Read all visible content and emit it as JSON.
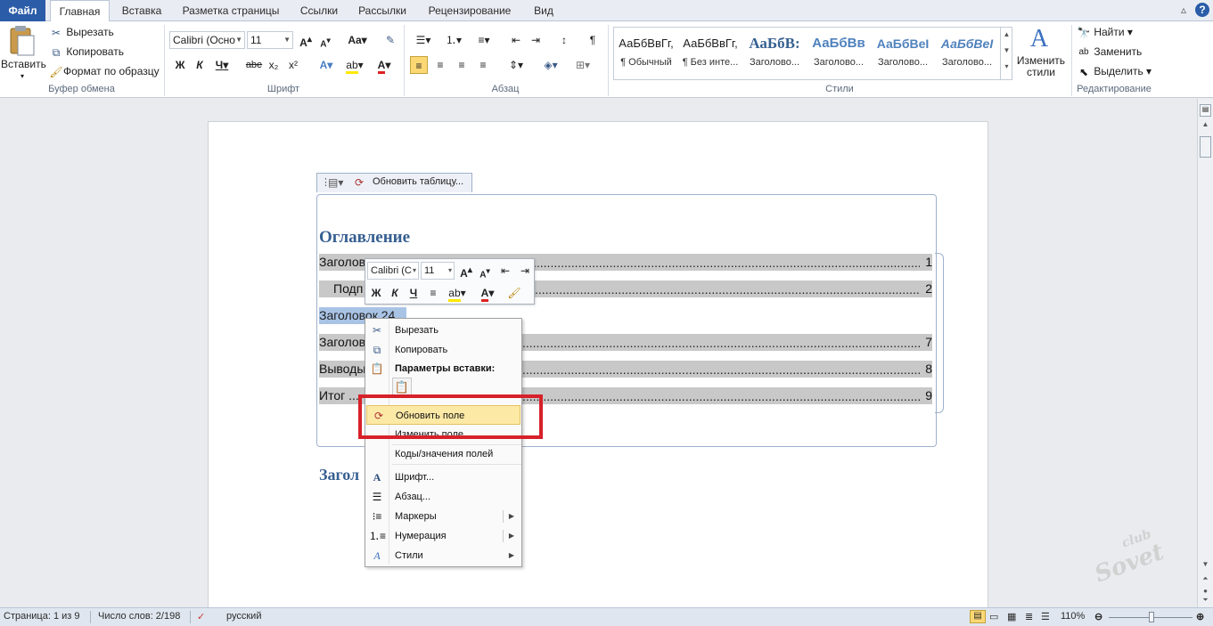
{
  "tabs": {
    "file": "Файл",
    "home": "Главная",
    "insert": "Вставка",
    "layout": "Разметка страницы",
    "references": "Ссылки",
    "mailings": "Рассылки",
    "review": "Рецензирование",
    "view": "Вид"
  },
  "clipboard": {
    "paste": "Вставить",
    "cut": "Вырезать",
    "copy": "Копировать",
    "format_painter": "Формат по образцу",
    "title": "Буфер обмена"
  },
  "font": {
    "name": "Calibri (Осно",
    "size": "11",
    "title": "Шрифт",
    "bold": "Ж",
    "italic": "К",
    "underline": "Ч",
    "strike": "abe",
    "subscript": "x₂",
    "superscript": "x²"
  },
  "paragraph": {
    "title": "Абзац"
  },
  "styles": {
    "title": "Стили",
    "items": [
      {
        "preview": "АаБбВвГг,",
        "name": "¶ Обычный"
      },
      {
        "preview": "АаБбВвГг,",
        "name": "¶ Без инте..."
      },
      {
        "preview": "АаБбВ:",
        "name": "Заголово..."
      },
      {
        "preview": "АаБбВв",
        "name": "Заголово..."
      },
      {
        "preview": "АаБбВеІ",
        "name": "Заголово..."
      },
      {
        "preview": "АаБбВеІ",
        "name": "Заголово..."
      }
    ],
    "change_styles": "Изменить стили"
  },
  "editing": {
    "find": "Найти",
    "replace": "Заменить",
    "select": "Выделить",
    "title": "Редактирование"
  },
  "toc": {
    "update_table": "Обновить таблицу...",
    "heading": "Оглавление",
    "rows": [
      {
        "text": "Заголов",
        "page": "1"
      },
      {
        "text": "Подп",
        "page": "2"
      },
      {
        "text": "Заголов",
        "page": "7"
      },
      {
        "text": "Выводы",
        "page": "8"
      },
      {
        "text": "Итог ...",
        "page": "9"
      }
    ],
    "selected_heading": "Заголовок 24",
    "below_heading": "Загол"
  },
  "minibar": {
    "font": "Calibri (С",
    "size": "11"
  },
  "context_menu": {
    "cut": "Вырезать",
    "copy": "Копировать",
    "paste_options": "Параметры вставки:",
    "update_field": "Обновить поле",
    "edit_field": "Изменить поле...",
    "field_codes": "Коды/значения полей",
    "font": "Шрифт...",
    "paragraph": "Абзац...",
    "bullets": "Маркеры",
    "numbering": "Нумерация",
    "styles": "Стили"
  },
  "status": {
    "page": "Страница: 1 из 9",
    "words": "Число слов: 2/198",
    "language": "русский",
    "zoom": "110%"
  },
  "watermark": "club Sovet",
  "colors": {
    "accent": "#2a5ca8",
    "highlight": "#d7212a",
    "heading": "#365f91",
    "toc_shade": "#c8c8c8"
  }
}
